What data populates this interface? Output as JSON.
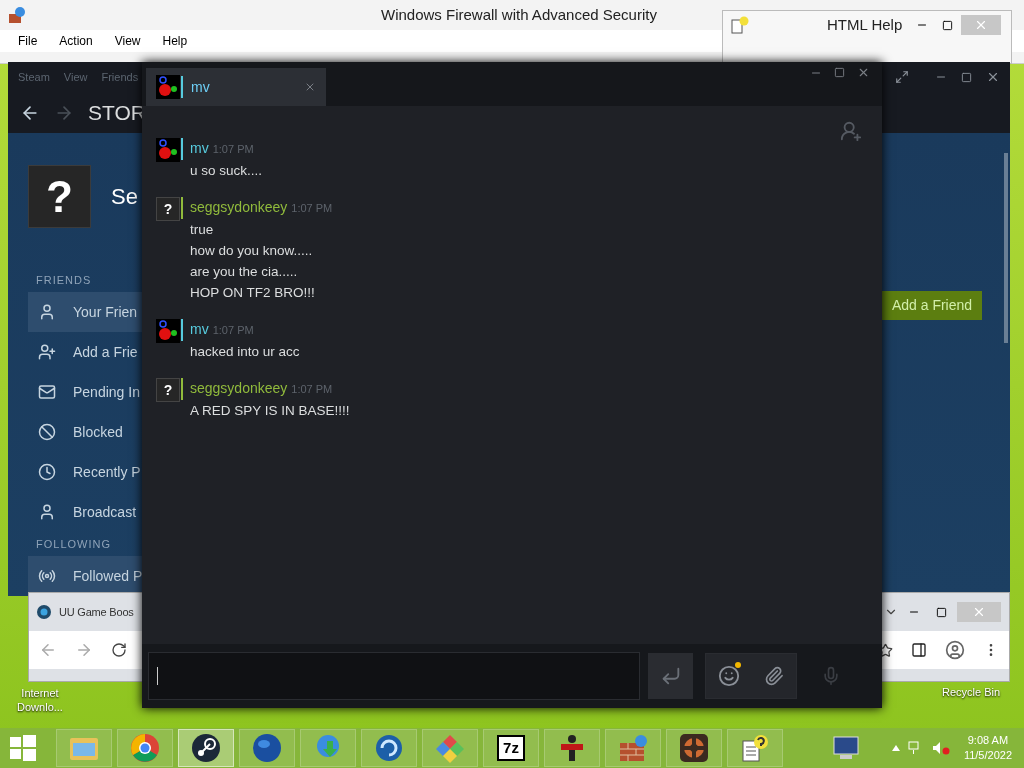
{
  "desktop": {
    "icons": [
      {
        "label": "Internet Downlo..."
      },
      {
        "label": "Recycle Bin"
      }
    ]
  },
  "firewall_window": {
    "title": "Windows Firewall with Advanced Security",
    "menu": [
      "File",
      "Action",
      "View",
      "Help"
    ]
  },
  "help_window": {
    "title": "HTML Help"
  },
  "steam_window": {
    "menu": [
      "Steam",
      "View",
      "Friends"
    ],
    "page_title": "STOR",
    "avatar_glyph": "?",
    "profile_name": "Se",
    "sections": [
      {
        "heading": "FRIENDS",
        "items": [
          {
            "label": "Your Frien",
            "kind": "person",
            "selected": true
          },
          {
            "label": "Add a Frie",
            "kind": "add",
            "selected": false
          },
          {
            "label": "Pending In",
            "kind": "mail",
            "selected": false
          },
          {
            "label": "Blocked",
            "kind": "blocked",
            "selected": false
          },
          {
            "label": "Recently P",
            "kind": "clock",
            "selected": false
          },
          {
            "label": "Broadcast",
            "kind": "person",
            "selected": false
          }
        ]
      },
      {
        "heading": "FOLLOWING",
        "items": [
          {
            "label": "Followed P",
            "kind": "follow",
            "selected": true
          }
        ]
      }
    ],
    "add_friend_button": "Add a Friend"
  },
  "browser_window": {
    "tab": "UU Game Boos"
  },
  "chat_window": {
    "tab": {
      "name": "mv"
    },
    "messages": [
      {
        "sender": "mv",
        "kind": "custom",
        "color": "#57cbde",
        "time": "1:07 PM",
        "lines": [
          "u so suck...."
        ]
      },
      {
        "sender": "seggsydonkeey",
        "kind": "default",
        "avatar_glyph": "?",
        "color": "#90ba3c",
        "time": "1:07 PM",
        "lines": [
          "true",
          "how do you know.....",
          "are you the cia.....",
          "HOP ON TF2 BRO!!!"
        ]
      },
      {
        "sender": "mv",
        "kind": "custom",
        "color": "#57cbde",
        "time": "1:07 PM",
        "lines": [
          "hacked into ur acc"
        ]
      },
      {
        "sender": "seggsydonkeey",
        "kind": "default",
        "avatar_glyph": "?",
        "color": "#90ba3c",
        "time": "1:07 PM",
        "lines": [
          "A RED SPY IS IN BASE!!!!"
        ]
      }
    ],
    "emoticon_notification": true
  },
  "taskbar": {
    "apps": [
      {
        "kind": "folder",
        "selected": false
      },
      {
        "kind": "chrome",
        "selected": false
      },
      {
        "kind": "steam",
        "selected": true
      },
      {
        "kind": "globe",
        "selected": false
      },
      {
        "kind": "download",
        "selected": false
      },
      {
        "kind": "swirl",
        "selected": false
      },
      {
        "kind": "diamonds",
        "selected": false
      },
      {
        "kind": "text",
        "label": "7z",
        "selected": false
      },
      {
        "kind": "figure",
        "selected": false
      },
      {
        "kind": "wall",
        "selected": false
      },
      {
        "kind": "tf",
        "selected": false
      },
      {
        "kind": "help",
        "selected": false
      }
    ],
    "time": "9:08 AM",
    "date": "11/5/2022"
  }
}
